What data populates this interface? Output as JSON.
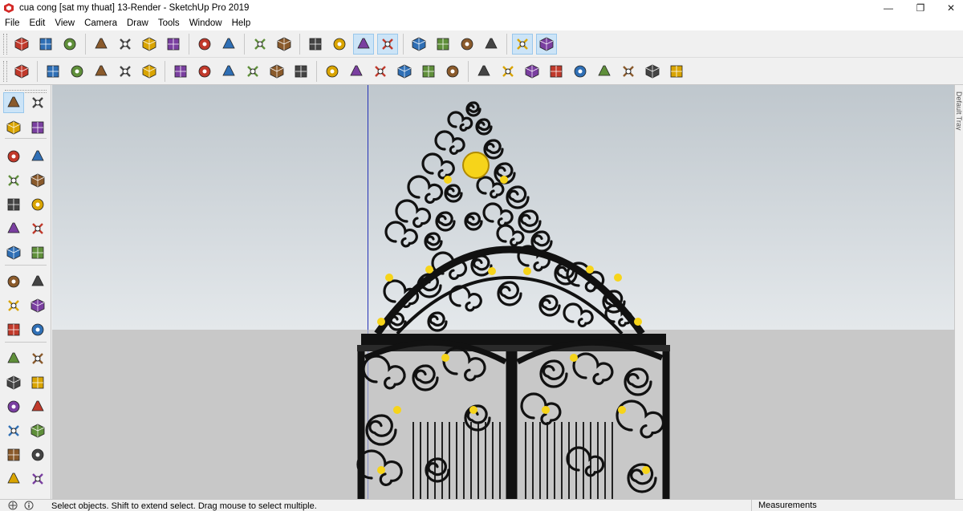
{
  "window": {
    "title": "cua cong [sat my thuat] 13-Render - SketchUp Pro 2019",
    "minimize": "—",
    "maximize": "❐",
    "close": "✕"
  },
  "menu": [
    "File",
    "Edit",
    "View",
    "Camera",
    "Draw",
    "Tools",
    "Window",
    "Help"
  ],
  "toolbar1": [
    {
      "icon": "new-file-icon"
    },
    {
      "icon": "open-icon"
    },
    {
      "icon": "save-icon"
    },
    {
      "icon": "cut-icon"
    },
    {
      "icon": "copy-icon"
    },
    {
      "icon": "paste-icon"
    },
    {
      "icon": "erase-icon"
    },
    {
      "icon": "undo-icon"
    },
    {
      "icon": "redo-icon"
    },
    {
      "icon": "print-icon"
    },
    {
      "icon": "model-info-icon"
    },
    {
      "icon": "parallel-projection-icon"
    },
    {
      "icon": "x-ray-icon"
    },
    {
      "icon": "back-edges-icon",
      "active": true
    },
    {
      "icon": "wireframe-icon",
      "active": true
    },
    {
      "icon": "hidden-line-icon"
    },
    {
      "icon": "shaded-icon"
    },
    {
      "icon": "shaded-textures-icon"
    },
    {
      "icon": "monochrome-icon"
    },
    {
      "icon": "layers-icon",
      "active": true
    },
    {
      "icon": "styles-icon",
      "active": true
    }
  ],
  "toolbar2": [
    {
      "icon": "components-icon"
    },
    {
      "icon": "group-icon"
    },
    {
      "icon": "solid-union-icon"
    },
    {
      "icon": "solid-subtract-icon"
    },
    {
      "icon": "solid-trim-icon"
    },
    {
      "icon": "solid-split-icon"
    },
    {
      "icon": "tape-measure-icon"
    },
    {
      "icon": "dimension-icon"
    },
    {
      "icon": "protractor-icon"
    },
    {
      "icon": "text-icon"
    },
    {
      "icon": "axes-icon"
    },
    {
      "icon": "3d-text-icon"
    },
    {
      "icon": "iso-view-icon"
    },
    {
      "icon": "top-view-icon"
    },
    {
      "icon": "front-view-icon"
    },
    {
      "icon": "right-view-icon"
    },
    {
      "icon": "back-view-icon"
    },
    {
      "icon": "left-view-icon"
    },
    {
      "icon": "orbit-icon"
    },
    {
      "icon": "pan-icon"
    },
    {
      "icon": "zoom-icon"
    },
    {
      "icon": "zoom-window-icon"
    },
    {
      "icon": "zoom-extents-icon"
    },
    {
      "icon": "position-camera-icon"
    },
    {
      "icon": "walk-icon"
    },
    {
      "icon": "look-around-icon"
    },
    {
      "icon": "footprints-icon"
    }
  ],
  "lefttools": [
    {
      "icon": "select-icon",
      "active": true
    },
    {
      "icon": "make-component-icon"
    },
    {
      "icon": "paint-bucket-icon"
    },
    {
      "icon": "eraser-icon"
    },
    {
      "icon": "line-icon"
    },
    {
      "icon": "freehand-icon"
    },
    {
      "icon": "rectangle-icon"
    },
    {
      "icon": "rotated-rectangle-icon"
    },
    {
      "icon": "circle-icon"
    },
    {
      "icon": "polygon-icon"
    },
    {
      "icon": "arc-icon"
    },
    {
      "icon": "two-point-arc-icon"
    },
    {
      "icon": "three-point-arc-icon"
    },
    {
      "icon": "pie-icon"
    },
    {
      "icon": "move-icon"
    },
    {
      "icon": "push-pull-icon"
    },
    {
      "icon": "rotate-icon"
    },
    {
      "icon": "follow-me-icon"
    },
    {
      "icon": "scale-icon"
    },
    {
      "icon": "offset-icon"
    },
    {
      "icon": "tape-measure-icon"
    },
    {
      "icon": "dimension-icon"
    },
    {
      "icon": "protractor-icon"
    },
    {
      "icon": "text-icon"
    },
    {
      "icon": "axes-icon"
    },
    {
      "icon": "3d-text-icon"
    },
    {
      "icon": "orbit-icon"
    },
    {
      "icon": "pan-icon"
    },
    {
      "icon": "zoom-icon"
    },
    {
      "icon": "zoom-window-icon"
    },
    {
      "icon": "zoom-extents-icon"
    },
    {
      "icon": "previous-view-icon"
    }
  ],
  "tray": {
    "label": "Default Tray"
  },
  "status": {
    "text": "Select objects. Shift to extend select. Drag mouse to select multiple.",
    "measurements_label": "Measurements"
  },
  "colors": {
    "accent": "#cce4f7",
    "iron": "#111111",
    "gold": "#f6d41a",
    "axis_blue": "#2431b6"
  }
}
